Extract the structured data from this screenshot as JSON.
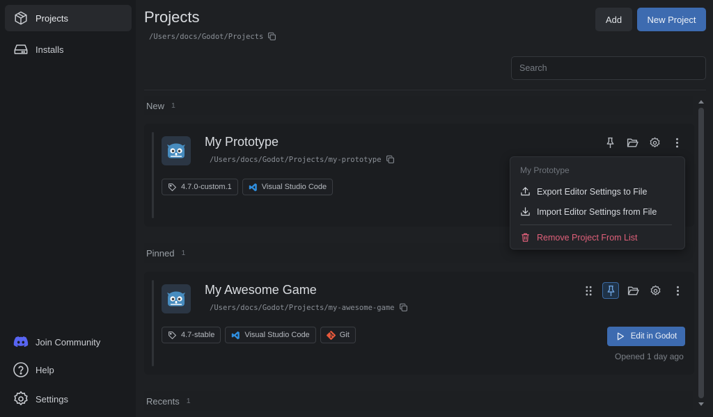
{
  "sidebar": {
    "items": [
      {
        "label": "Projects",
        "icon": "box-icon"
      },
      {
        "label": "Installs",
        "icon": "drive-icon"
      }
    ],
    "bottom": [
      {
        "label": "Join Community",
        "icon": "discord-icon"
      },
      {
        "label": "Help",
        "icon": "help-circle-icon"
      },
      {
        "label": "Settings",
        "icon": "gear-icon"
      }
    ]
  },
  "header": {
    "title": "Projects",
    "path": "/Users/docs/Godot/Projects",
    "add_label": "Add",
    "new_project_label": "New Project",
    "search_placeholder": "Search"
  },
  "sections": {
    "new": {
      "label": "New",
      "count": "1"
    },
    "pinned": {
      "label": "Pinned",
      "count": "1"
    },
    "recents": {
      "label": "Recents",
      "count": "1"
    }
  },
  "projects": {
    "prototype": {
      "title": "My Prototype",
      "path": "/Users/docs/Godot/Projects/my-prototype",
      "tags": [
        "4.7.0-custom.1",
        "Visual Studio Code"
      ]
    },
    "awesome": {
      "title": "My Awesome Game",
      "path": "/Users/docs/Godot/Projects/my-awesome-game",
      "tags": [
        "4.7-stable",
        "Visual Studio Code",
        "Git"
      ],
      "edit_label": "Edit in Godot",
      "opened": "Opened 1 day ago"
    }
  },
  "context_menu": {
    "title": "My Prototype",
    "export_label": "Export Editor Settings to File",
    "import_label": "Import Editor Settings from File",
    "remove_label": "Remove Project From List"
  },
  "colors": {
    "accent": "#3d6bb0",
    "danger": "#e0607a",
    "vscode": "#2f8fe0",
    "git": "#e5583b",
    "discord": "#5865f2"
  }
}
